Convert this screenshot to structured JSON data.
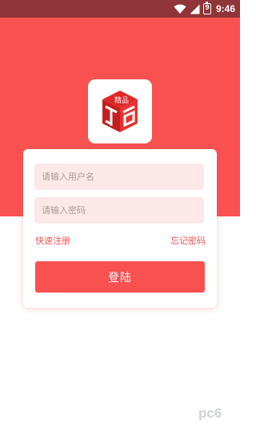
{
  "status_bar": {
    "time": "9:46",
    "battery_level": "9",
    "icons": [
      "wifi-icon",
      "signal-icon",
      "battery-icon"
    ]
  },
  "app": {
    "logo_text": "精品",
    "logo_icon": "box-logo-icon"
  },
  "login_form": {
    "username_placeholder": "请输入用户名",
    "username_value": "",
    "password_placeholder": "请输入密码",
    "password_value": "",
    "register_link": "快速注册",
    "forgot_password_link": "忘记密码",
    "login_button": "登陆"
  },
  "watermark": {
    "text": "pc6"
  },
  "colors": {
    "status_bar": "#8f3438",
    "brand_red": "#fa5151",
    "input_bg": "#fce8e8",
    "card_bg": "#ffffff",
    "logo_red": "#e02828",
    "watermark": "#cfd3d8"
  }
}
